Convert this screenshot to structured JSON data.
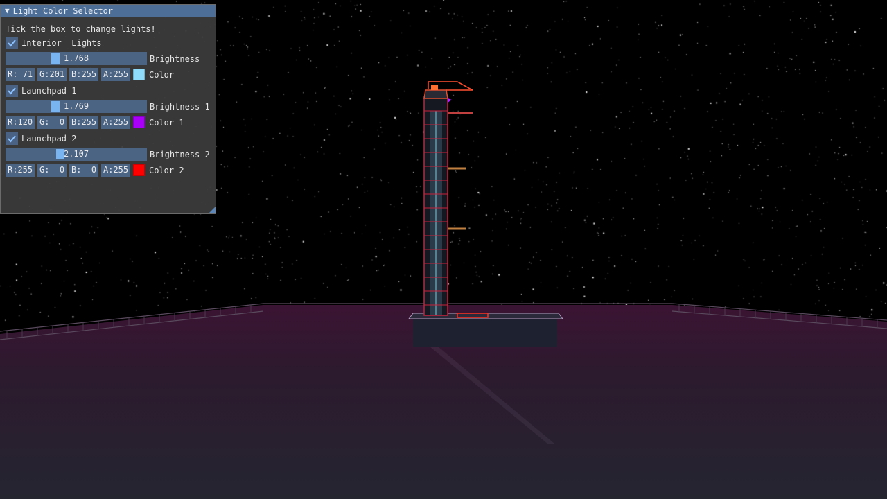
{
  "window": {
    "title": "Light Color Selector",
    "hint": "Tick the box to change lights!"
  },
  "groups": [
    {
      "checkbox_label": "Interior  Lights",
      "checked": true,
      "slider_value": "1.768",
      "slider_fraction": 0.11,
      "slider_label": "Brightness",
      "channels": [
        "R: 71",
        "G:201",
        "B:255",
        "A:255"
      ],
      "color_hex": "#8fdcfa",
      "color_label": "Color"
    },
    {
      "checkbox_label": "Launchpad 1",
      "checked": true,
      "slider_value": "1.769",
      "slider_fraction": 0.11,
      "slider_label": "Brightness 1",
      "channels": [
        "R:120",
        "G:  0",
        "B:255",
        "A:255"
      ],
      "color_hex": "#a800f8",
      "color_label": "Color 1"
    },
    {
      "checkbox_label": "Launchpad 2",
      "checked": true,
      "slider_value": "2.107",
      "slider_fraction": 0.2,
      "slider_label": "Brightness 2",
      "channels": [
        "R:255",
        "G:  0",
        "B:  0",
        "A:255"
      ],
      "color_hex": "#ff0000",
      "color_label": "Color 2"
    }
  ],
  "colors": {
    "title_bar": "#4d6f97",
    "frame": "#4b6484",
    "accent": "#7ab4f0",
    "tower": "#c8203a",
    "ground": "#3a1530"
  }
}
